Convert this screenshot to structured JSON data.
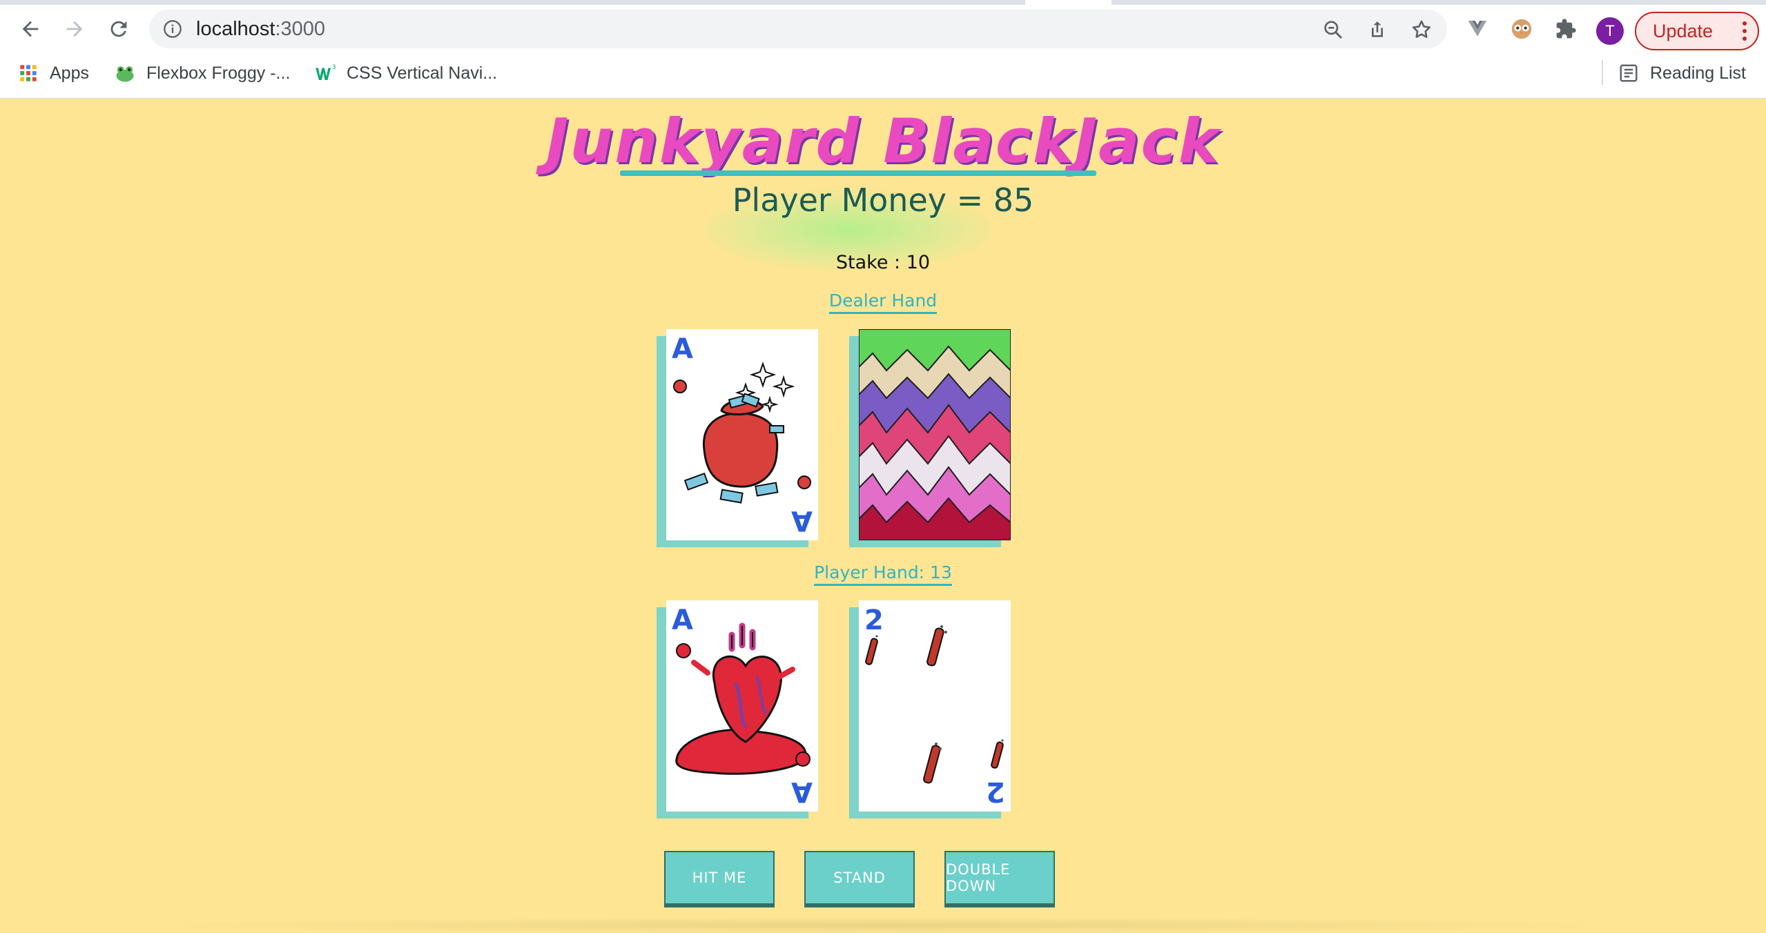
{
  "browser": {
    "url_host": "localhost",
    "url_port": ":3000",
    "update_label": "Update",
    "avatar_letter": "T",
    "bookmarks": [
      {
        "label": "Apps",
        "icon": "apps-grid-icon"
      },
      {
        "label": "Flexbox Froggy -...",
        "icon": "frog-icon"
      },
      {
        "label": "CSS Vertical Navi...",
        "icon": "w3schools-icon"
      }
    ],
    "reading_list_label": "Reading List"
  },
  "game": {
    "title": "Junkyard BlackJack",
    "money_label": "Player Money = 85",
    "stake_label": "Stake : 10",
    "dealer_label": "Dealer Hand",
    "player_label": "Player Hand: 13",
    "dealer_cards": [
      {
        "rank": "A",
        "face": "up",
        "art": "money-bag-icon"
      },
      {
        "rank": "",
        "face": "down",
        "art": "card-back-zigzag"
      }
    ],
    "player_cards": [
      {
        "rank": "A",
        "face": "up",
        "art": "heart-organ-icon"
      },
      {
        "rank": "2",
        "face": "up",
        "art": "spiked-bat-icon"
      }
    ],
    "buttons": {
      "hit": "HIT ME",
      "stand": "STAND",
      "double": "DOUBLE DOWN"
    }
  },
  "colors": {
    "page_bg": "#fde594",
    "title": "#e94ac0",
    "accent_teal": "#6bd0c9",
    "rank_blue": "#2a5bdb"
  }
}
